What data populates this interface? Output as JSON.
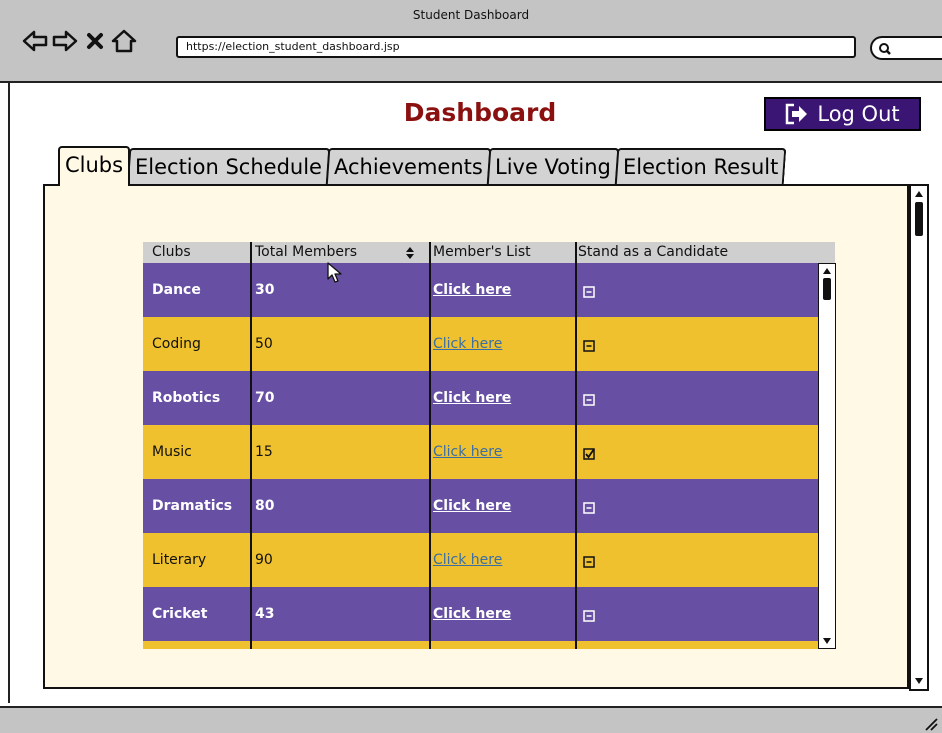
{
  "window": {
    "title": "Student Dashboard"
  },
  "browser": {
    "url": "https://election_student_dashboard.jsp",
    "icons": {
      "back": "back-arrow-icon",
      "forward": "forward-arrow-icon",
      "stop": "close-icon",
      "home": "home-icon",
      "search": "search-icon"
    }
  },
  "header": {
    "title": "Dashboard",
    "logout_label": "Log Out",
    "logout_icon": "logout-icon"
  },
  "tabs": [
    {
      "label": "Clubs",
      "active": true
    },
    {
      "label": "Election Schedule",
      "active": false
    },
    {
      "label": "Achievements",
      "active": false
    },
    {
      "label": "Live Voting",
      "active": false
    },
    {
      "label": "Election Result",
      "active": false
    }
  ],
  "table": {
    "columns": [
      "Clubs",
      "Total Members",
      "Member's List",
      "Stand as a Candidate"
    ],
    "rows": [
      {
        "club": "Dance",
        "members": "30",
        "link": "Click here",
        "candidate": false
      },
      {
        "club": "Coding",
        "members": "50",
        "link": "Click here",
        "candidate": false
      },
      {
        "club": "Robotics",
        "members": "70",
        "link": "Click here",
        "candidate": false
      },
      {
        "club": "Music",
        "members": "15",
        "link": "Click here",
        "candidate": true
      },
      {
        "club": "Dramatics",
        "members": "80",
        "link": "Click here",
        "candidate": false
      },
      {
        "club": "Literary",
        "members": "90",
        "link": "Click here",
        "candidate": false
      },
      {
        "club": "Cricket",
        "members": "43",
        "link": "Click here",
        "candidate": false
      }
    ]
  },
  "colors": {
    "purple_row": "#6750a4",
    "yellow_row": "#f0c12f",
    "title_red": "#8b1010",
    "logout_bg": "#3b1573",
    "panel_bg": "#fff9e6",
    "chrome_gray": "#c4c4c4"
  }
}
